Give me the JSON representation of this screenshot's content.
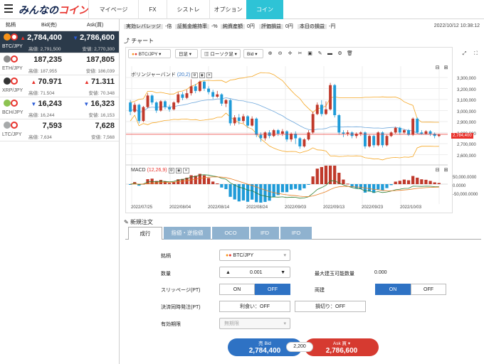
{
  "app": {
    "logo_main": "みんなの",
    "logo_accent": "コイン"
  },
  "nav": {
    "tabs": [
      "マイページ",
      "FX",
      "シストレ",
      "オプション",
      "コイン"
    ],
    "active": "コイン"
  },
  "status_bar": [
    {
      "label": "実効レバレッジ",
      "value": "-倍"
    },
    {
      "label": "証拠金維持率",
      "value": "-%"
    },
    {
      "label": "純資産額",
      "value": "0円"
    },
    {
      "label": "評価損益",
      "value": "0円"
    },
    {
      "label": "本日の損益",
      "value": "-円"
    }
  ],
  "datetime": "2022/10/12 10:38:12",
  "price_list": {
    "headers": {
      "symbol": "銘柄",
      "bid": "Bid(売)",
      "ask": "Ask(買)"
    },
    "rows": [
      {
        "symbol": "BTC/JPY",
        "bid": "2,784,400",
        "ask": "2,786,600",
        "bid_dir": "up",
        "ask_dir": "down",
        "high": "高値: 2,791,500",
        "low": "安値: 2,770,300",
        "selected": true,
        "color": "#f7931a"
      },
      {
        "symbol": "ETH/JPY",
        "bid": "187,235",
        "ask": "187,805",
        "bid_dir": "none",
        "ask_dir": "none",
        "high": "高値: 187,955",
        "low": "安値: 186,039",
        "selected": false,
        "color": "#8c8c8c"
      },
      {
        "symbol": "XRP/JPY",
        "bid": "70.971",
        "ask": "71.311",
        "bid_dir": "up",
        "ask_dir": "up",
        "high": "高値: 71.504",
        "low": "安値: 70.348",
        "selected": false,
        "color": "#333333"
      },
      {
        "symbol": "BCH/JPY",
        "bid": "16,243",
        "ask": "16,323",
        "bid_dir": "down",
        "ask_dir": "down",
        "high": "高値: 16,244",
        "low": "安値: 16,153",
        "selected": false,
        "color": "#8dc351"
      },
      {
        "symbol": "LTC/JPY",
        "bid": "7,593",
        "ask": "7,628",
        "bid_dir": "none",
        "ask_dir": "none",
        "high": "高値: 7,634",
        "low": "安値: 7,568",
        "selected": false,
        "color": "#a6a9aa"
      }
    ]
  },
  "chart_section": {
    "title": "チャート",
    "symbol": "BTC/JPY",
    "timeframe": "日足",
    "chart_type": "ローソク足",
    "price_side": "Bid",
    "indicator_main": "ボリンジャーバンド",
    "indicator_main_params": "(20,2)",
    "indicator_sub": "MACD",
    "indicator_sub_params": "(12,26,9)",
    "current_price_label": "2,784,400"
  },
  "chart_data": {
    "type": "candlestick",
    "y_ticks": [
      "3,300,000",
      "3,200,000",
      "3,100,000",
      "3,000,000",
      "2,900,000",
      "2,800,000",
      "2,700,000",
      "2,600,000"
    ],
    "macd_ticks": [
      "50,000.0000",
      "0.0000",
      "-50,000.0000"
    ],
    "x_ticks": [
      "2022/07/25",
      "2022/08/04",
      "2022/08/14",
      "2022/08/24",
      "2022/09/03",
      "2022/09/13",
      "2022/09/23",
      "2022/10/03"
    ],
    "ylim": [
      2550000,
      3350000
    ],
    "candles": [
      [
        3060000,
        2980000,
        3080000,
        2950000
      ],
      [
        2980000,
        3040000,
        3060000,
        2970000
      ],
      [
        3040000,
        2900000,
        3050000,
        2880000
      ],
      [
        2900000,
        3020000,
        3030000,
        2890000
      ],
      [
        3020000,
        3120000,
        3140000,
        3010000
      ],
      [
        3120000,
        3060000,
        3130000,
        3040000
      ],
      [
        3060000,
        2990000,
        3070000,
        2970000
      ],
      [
        2990000,
        3070000,
        3080000,
        2980000
      ],
      [
        3070000,
        3020000,
        3080000,
        3000000
      ],
      [
        3020000,
        3000000,
        3040000,
        2980000
      ],
      [
        3000000,
        3060000,
        3070000,
        2990000
      ],
      [
        3060000,
        3130000,
        3150000,
        3050000
      ],
      [
        3130000,
        3100000,
        3150000,
        3080000
      ],
      [
        3100000,
        3140000,
        3170000,
        3090000
      ],
      [
        3140000,
        3200000,
        3260000,
        3120000
      ],
      [
        3200000,
        3160000,
        3220000,
        3140000
      ],
      [
        3160000,
        3240000,
        3250000,
        3150000
      ],
      [
        3240000,
        3180000,
        3250000,
        3160000
      ],
      [
        3180000,
        3150000,
        3200000,
        3130000
      ],
      [
        3150000,
        3110000,
        3170000,
        3090000
      ],
      [
        3110000,
        3130000,
        3160000,
        3100000
      ],
      [
        3130000,
        3050000,
        3140000,
        3030000
      ],
      [
        3050000,
        3080000,
        3090000,
        3020000
      ],
      [
        3080000,
        2880000,
        3090000,
        2860000
      ],
      [
        2880000,
        2930000,
        2950000,
        2860000
      ],
      [
        2930000,
        2900000,
        2960000,
        2870000
      ],
      [
        2900000,
        2940000,
        2960000,
        2880000
      ],
      [
        2940000,
        2860000,
        2950000,
        2840000
      ],
      [
        2860000,
        2920000,
        2940000,
        2850000
      ],
      [
        2920000,
        2780000,
        2930000,
        2760000
      ],
      [
        2780000,
        2750000,
        2800000,
        2720000
      ],
      [
        2750000,
        2800000,
        2810000,
        2730000
      ],
      [
        2800000,
        2770000,
        2820000,
        2750000
      ],
      [
        2770000,
        2820000,
        2830000,
        2760000
      ],
      [
        2820000,
        2790000,
        2830000,
        2770000
      ],
      [
        2790000,
        2810000,
        2830000,
        2770000
      ],
      [
        2810000,
        2740000,
        2820000,
        2720000
      ],
      [
        2740000,
        2790000,
        2800000,
        2720000
      ],
      [
        2790000,
        2750000,
        2810000,
        2700000
      ],
      [
        2750000,
        2680000,
        2760000,
        2660000
      ],
      [
        2680000,
        2740000,
        2750000,
        2670000
      ],
      [
        2740000,
        2800000,
        2820000,
        2730000
      ],
      [
        2800000,
        2960000,
        2980000,
        2790000
      ],
      [
        2960000,
        3040000,
        3060000,
        2950000
      ],
      [
        3040000,
        2960000,
        3080000,
        2940000
      ],
      [
        2960000,
        3000000,
        3070000,
        2950000
      ],
      [
        3000000,
        3210000,
        3230000,
        2990000
      ],
      [
        3210000,
        2950000,
        3220000,
        2930000
      ],
      [
        2950000,
        2800000,
        2960000,
        2780000
      ],
      [
        2800000,
        2790000,
        2820000,
        2760000
      ],
      [
        2790000,
        2800000,
        2820000,
        2770000
      ],
      [
        2800000,
        2770000,
        2810000,
        2750000
      ],
      [
        2770000,
        2790000,
        2800000,
        2750000
      ],
      [
        2790000,
        2800000,
        2810000,
        2770000
      ],
      [
        2800000,
        2680000,
        2810000,
        2660000
      ],
      [
        2680000,
        2770000,
        2780000,
        2670000
      ],
      [
        2770000,
        2690000,
        2780000,
        2670000
      ],
      [
        2690000,
        2800000,
        2810000,
        2680000
      ],
      [
        2800000,
        2690000,
        2810000,
        2670000
      ],
      [
        2690000,
        2770000,
        2780000,
        2680000
      ],
      [
        2770000,
        2800000,
        2810000,
        2760000
      ],
      [
        2800000,
        2840000,
        2850000,
        2790000
      ],
      [
        2840000,
        2800000,
        2850000,
        2780000
      ],
      [
        2800000,
        2820000,
        2830000,
        2790000
      ],
      [
        2820000,
        2780000,
        2830000,
        2770000
      ],
      [
        2780000,
        2920000,
        2930000,
        2770000
      ],
      [
        2920000,
        2800000,
        2930000,
        2790000
      ],
      [
        2800000,
        2790000,
        2820000,
        2780000
      ],
      [
        2790000,
        2810000,
        2820000,
        2780000
      ],
      [
        2810000,
        2790000,
        2820000,
        2770000
      ],
      [
        2790000,
        2770000,
        2800000,
        2750000
      ],
      [
        2770000,
        2780000,
        2790000,
        2760000
      ]
    ]
  },
  "order": {
    "title": "新規注文",
    "tabs": [
      "成行",
      "指値・逆指値",
      "OCO",
      "IFD",
      "IFO"
    ],
    "active_tab": "成行",
    "fields": {
      "symbol_label": "銘柄",
      "symbol_value": "BTC/JPY",
      "qty_label": "数量",
      "qty_value": "0.001",
      "max_label": "最大建玉可能数量",
      "max_value": "0.000",
      "slippage_label": "スリッページ(PT)",
      "on": "ON",
      "off": "OFF",
      "both_label": "両建",
      "settle_label": "決済同時発注(PT)",
      "take_profit": "利食い：OFF",
      "stop_loss": "損切り：OFF",
      "expiry_label": "有効期限",
      "expiry_value": "無期限"
    },
    "sell_label": "売 Bid",
    "sell_price": "2,784,400",
    "buy_label": "Ask 買",
    "buy_price": "2,786,600",
    "spread": "2,200",
    "sell_color": "#2e72c4",
    "buy_color": "#d63a30"
  }
}
